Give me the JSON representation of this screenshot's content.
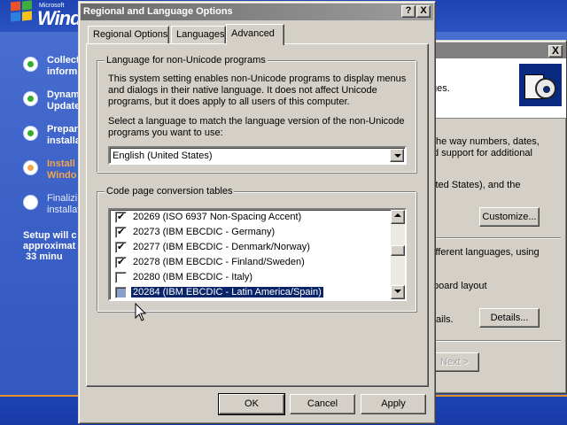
{
  "setup": {
    "logo_small": "Microsoft",
    "logo_text": "Windo",
    "steps": [
      {
        "label": "Collect\ninform",
        "state": "done"
      },
      {
        "label": "Dynam\nUpdate",
        "state": "done"
      },
      {
        "label": "Prepar\ninstalla",
        "state": "done"
      },
      {
        "label": "Install\nWindo",
        "state": "active"
      },
      {
        "label": "Finalizi\ninstallat",
        "state": "pending"
      }
    ],
    "time_remaining": "Setup will c\napproximat\n 33 minu"
  },
  "background_dialog": {
    "close_label": "X",
    "header_text": "ges.",
    "text_1": "the way numbers, dates,\nd support for additional",
    "text_2": "ited States), and the",
    "customize_label": "Customize...",
    "text_3": "ifferent languages, using",
    "text_4": "board layout",
    "text_5": "tails.",
    "details_label": "Details...",
    "next_label": "Next >"
  },
  "dialog": {
    "title": "Regional and Language Options",
    "help_label": "?",
    "close_label": "X",
    "tabs": [
      {
        "label": "Regional Options",
        "selected": false
      },
      {
        "label": "Languages",
        "selected": false
      },
      {
        "label": "Advanced",
        "selected": true
      }
    ],
    "group_language": {
      "legend": "Language for non-Unicode programs",
      "description": "This system setting enables non-Unicode programs to display menus and dialogs in their native language. It does not affect Unicode programs, but it does apply to all users of this computer.",
      "select_label": "Select a language to match the language version of the non-Unicode programs you want to use:",
      "selected_language": "English (United States)"
    },
    "group_codepage": {
      "legend": "Code page conversion tables",
      "items": [
        {
          "label": "20269 (ISO 6937 Non-Spacing Accent)",
          "checked": true,
          "selected": false
        },
        {
          "label": "20273 (IBM EBCDIC - Germany)",
          "checked": true,
          "selected": false
        },
        {
          "label": "20277 (IBM EBCDIC - Denmark/Norway)",
          "checked": true,
          "selected": false
        },
        {
          "label": "20278 (IBM EBCDIC - Finland/Sweden)",
          "checked": true,
          "selected": false
        },
        {
          "label": "20280 (IBM EBCDIC - Italy)",
          "checked": false,
          "selected": false
        },
        {
          "label": "20284 (IBM EBCDIC - Latin America/Spain)",
          "checked": false,
          "selected": true
        }
      ]
    },
    "buttons": {
      "ok": "OK",
      "cancel": "Cancel",
      "apply": "Apply"
    }
  }
}
